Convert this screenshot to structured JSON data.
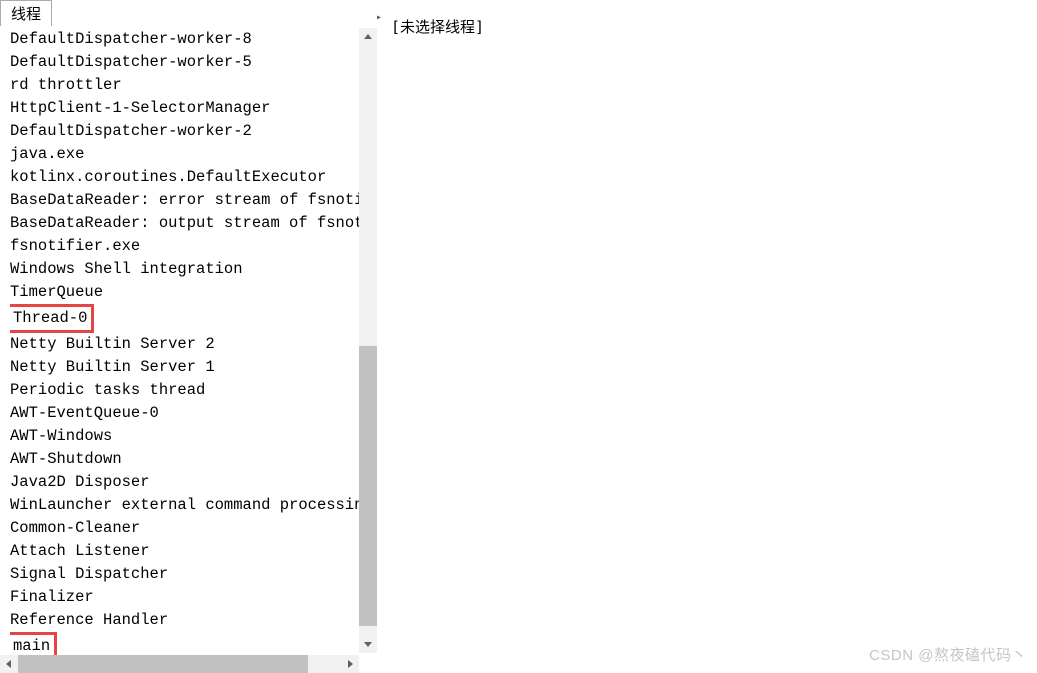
{
  "tab": {
    "label": "线程"
  },
  "threads": [
    {
      "name": "DefaultDispatcher-worker-8",
      "highlighted": false
    },
    {
      "name": "DefaultDispatcher-worker-5",
      "highlighted": false
    },
    {
      "name": "rd throttler",
      "highlighted": false
    },
    {
      "name": "HttpClient-1-SelectorManager",
      "highlighted": false
    },
    {
      "name": "DefaultDispatcher-worker-2",
      "highlighted": false
    },
    {
      "name": "java.exe",
      "highlighted": false
    },
    {
      "name": "kotlinx.coroutines.DefaultExecutor",
      "highlighted": false
    },
    {
      "name": "BaseDataReader: error stream of fsnoti",
      "highlighted": false
    },
    {
      "name": "BaseDataReader: output stream of fsnot",
      "highlighted": false
    },
    {
      "name": "fsnotifier.exe",
      "highlighted": false
    },
    {
      "name": "Windows Shell integration",
      "highlighted": false
    },
    {
      "name": "TimerQueue",
      "highlighted": false
    },
    {
      "name": "Thread-0",
      "highlighted": true
    },
    {
      "name": "Netty Builtin Server 2",
      "highlighted": false
    },
    {
      "name": "Netty Builtin Server 1",
      "highlighted": false
    },
    {
      "name": "Periodic tasks thread",
      "highlighted": false
    },
    {
      "name": "AWT-EventQueue-0",
      "highlighted": false
    },
    {
      "name": "AWT-Windows",
      "highlighted": false
    },
    {
      "name": "AWT-Shutdown",
      "highlighted": false
    },
    {
      "name": "Java2D Disposer",
      "highlighted": false
    },
    {
      "name": "WinLauncher external command processin",
      "highlighted": false
    },
    {
      "name": "Common-Cleaner",
      "highlighted": false
    },
    {
      "name": "Attach Listener",
      "highlighted": false
    },
    {
      "name": "Signal Dispatcher",
      "highlighted": false
    },
    {
      "name": "Finalizer",
      "highlighted": false
    },
    {
      "name": "Reference Handler",
      "highlighted": false
    },
    {
      "name": "main",
      "highlighted": true
    }
  ],
  "detail": {
    "placeholder": "[未选择线程]"
  },
  "watermark": "CSDN @熬夜磕代码丶"
}
